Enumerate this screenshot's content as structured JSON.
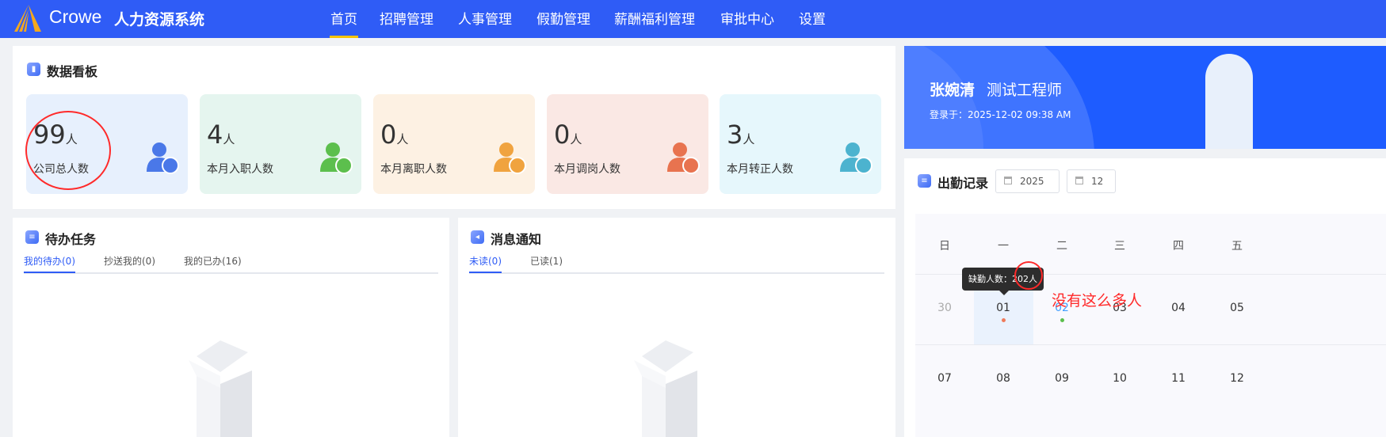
{
  "header": {
    "brand": "Crowe",
    "system": "人力资源系统",
    "nav": [
      "首页",
      "招聘管理",
      "人事管理",
      "假勤管理",
      "薪酬福利管理",
      "审批中心",
      "设置"
    ],
    "active": 0
  },
  "dashboard": {
    "title": "数据看板",
    "unit": "人",
    "cards": [
      {
        "value": "99",
        "label": "公司总人数",
        "color": "#e7f0fd",
        "icon": "group-icon",
        "iconColor": "#4a78e8"
      },
      {
        "value": "4",
        "label": "本月入职人数",
        "color": "#e5f5ef",
        "icon": "user-check-icon",
        "iconColor": "#5cbf4d"
      },
      {
        "value": "0",
        "label": "本月离职人数",
        "color": "#fdf1e3",
        "icon": "user-leave-icon",
        "iconColor": "#f0a33f"
      },
      {
        "value": "0",
        "label": "本月调岗人数",
        "color": "#fae8e4",
        "icon": "user-transfer-icon",
        "iconColor": "#e8734f"
      },
      {
        "value": "3",
        "label": "本月转正人数",
        "color": "#e6f7fc",
        "icon": "user-regular-icon",
        "iconColor": "#4cb3cf"
      }
    ]
  },
  "todo": {
    "title": "待办任务",
    "tabs": [
      "我的待办(0)",
      "抄送我的(0)",
      "我的已办(16)"
    ]
  },
  "messages": {
    "title": "消息通知",
    "tabs": [
      "未读(0)",
      "已读(1)"
    ]
  },
  "profile": {
    "name": "张婉清",
    "role": "测试工程师",
    "login": "登录于：2025-12-02 09:38 AM"
  },
  "attendance": {
    "title": "出勤记录",
    "year": "2025",
    "month": "12",
    "weekdays": [
      "日",
      "一",
      "二",
      "三",
      "四",
      "五"
    ],
    "week1": [
      "30",
      "01",
      "02",
      "03",
      "04",
      "05"
    ],
    "week2": [
      "07",
      "08",
      "09",
      "10",
      "11",
      "12"
    ],
    "tooltip": "缺勤人数：202人"
  },
  "annotation": {
    "text": "没有这么多人",
    "color": "#ff2a2a"
  }
}
